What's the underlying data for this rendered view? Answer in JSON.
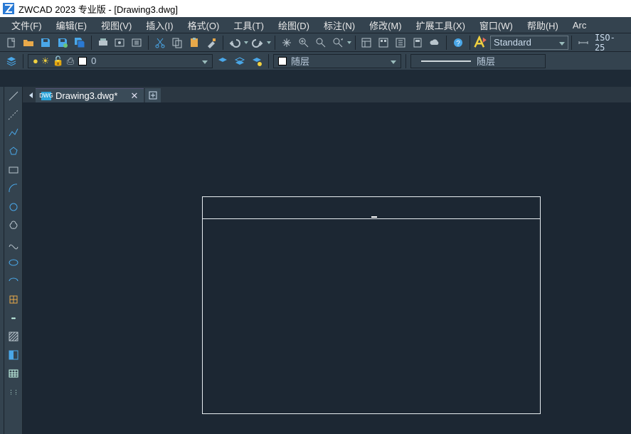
{
  "title": "ZWCAD 2023 专业版 - [Drawing3.dwg]",
  "menu": {
    "file": "文件(F)",
    "edit": "编辑(E)",
    "view": "视图(V)",
    "insert": "插入(I)",
    "format": "格式(O)",
    "tools": "工具(T)",
    "draw": "绘图(D)",
    "annotate": "标注(N)",
    "modify": "修改(M)",
    "ext": "扩展工具(X)",
    "window": "窗口(W)",
    "help": "帮助(H)",
    "arc": "Arc"
  },
  "style": {
    "text_style": "Standard",
    "dim_style": "ISO-25"
  },
  "layer": {
    "current": "0",
    "color_label": "随层",
    "linetype_label": "随层"
  },
  "tab": {
    "active": "Drawing3.dwg*",
    "file_badge": "DWG"
  }
}
